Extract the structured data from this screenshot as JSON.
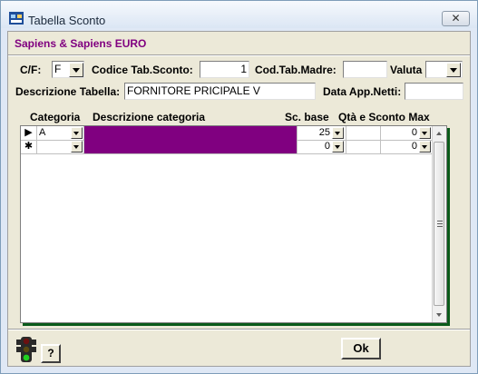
{
  "window": {
    "title": "Tabella Sconto",
    "close_label": "✕"
  },
  "company": "Sapiens & Sapiens EURO",
  "form": {
    "cf_label": "C/F:",
    "cf_value": "F",
    "codice_label": "Codice Tab.Sconto:",
    "codice_value": "1",
    "cod_madre_label": "Cod.Tab.Madre:",
    "cod_madre_value": "",
    "valuta_label": "Valuta",
    "valuta_value": "",
    "descrizione_label": "Descrizione Tabella:",
    "descrizione_value": "FORNITORE PRICIPALE V",
    "data_label": "Data App.Netti:",
    "data_value": ""
  },
  "grid": {
    "headers": {
      "categoria": "Categoria",
      "descrizione": "Descrizione categoria",
      "sc_base": "Sc. base",
      "qta": "Qtà e Sconto Max"
    },
    "rows": [
      {
        "indicator": "▶",
        "categoria": "A",
        "sc_base": "25",
        "qta": "",
        "sconto_max": "0"
      },
      {
        "indicator": "✱",
        "categoria": "",
        "sc_base": "0",
        "qta": "",
        "sconto_max": "0"
      }
    ]
  },
  "buttons": {
    "help": "?",
    "ok": "Ok"
  },
  "colors": {
    "accent": "#800080",
    "shadow_green": "#0a5a1a"
  }
}
